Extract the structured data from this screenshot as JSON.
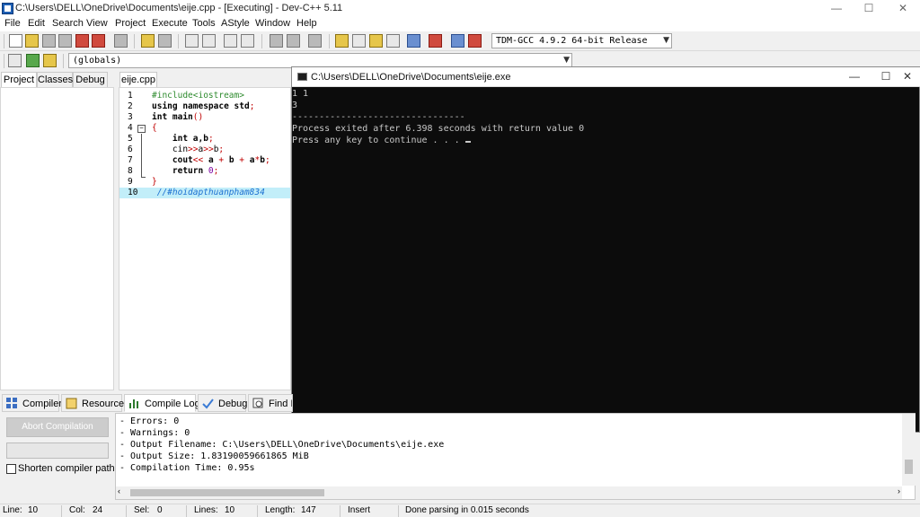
{
  "window": {
    "title": "C:\\Users\\DELL\\OneDrive\\Documents\\eije.cpp - [Executing] - Dev-C++ 5.11",
    "minimize": "—",
    "maximize": "☐",
    "close": "✕"
  },
  "menu": [
    "File",
    "Edit",
    "Search",
    "View",
    "Project",
    "Execute",
    "Tools",
    "AStyle",
    "Window",
    "Help"
  ],
  "toolbar": {
    "compiler_select": "TDM-GCC 4.9.2 64-bit Release",
    "scope_select": "(globals)"
  },
  "left_panel": {
    "tabs": [
      "Project",
      "Classes",
      "Debug"
    ]
  },
  "editor": {
    "file_tab": "eije.cpp",
    "lines": [
      {
        "n": "1",
        "segments": [
          {
            "t": "#include<iostream>",
            "c": "pp"
          }
        ]
      },
      {
        "n": "2",
        "segments": [
          {
            "t": "using namespace",
            "c": "kw"
          },
          {
            "t": " std",
            "c": "kw"
          },
          {
            "t": ";",
            "c": "op"
          }
        ]
      },
      {
        "n": "3",
        "segments": [
          {
            "t": "int",
            "c": "kw"
          },
          {
            "t": " main",
            "c": "kw"
          },
          {
            "t": "()",
            "c": "op"
          }
        ]
      },
      {
        "n": "4",
        "segments": [
          {
            "t": "{",
            "c": "op"
          }
        ]
      },
      {
        "n": "5",
        "segments": [
          {
            "t": "    int",
            "c": "kw"
          },
          {
            "t": " a,b",
            "c": "kw"
          },
          {
            "t": ";",
            "c": "op"
          }
        ]
      },
      {
        "n": "6",
        "segments": [
          {
            "t": "    cin",
            "c": ""
          },
          {
            "t": ">>",
            "c": "op"
          },
          {
            "t": "a",
            "c": ""
          },
          {
            "t": ">>",
            "c": "op"
          },
          {
            "t": "b",
            "c": ""
          },
          {
            "t": ";",
            "c": "op"
          }
        ]
      },
      {
        "n": "7",
        "segments": [
          {
            "t": "    cout",
            "c": "kw"
          },
          {
            "t": "<<",
            "c": "op"
          },
          {
            "t": " a ",
            "c": "kw"
          },
          {
            "t": "+",
            "c": "op"
          },
          {
            "t": " b ",
            "c": "kw"
          },
          {
            "t": "+",
            "c": "op"
          },
          {
            "t": " a",
            "c": "kw"
          },
          {
            "t": "*",
            "c": "op"
          },
          {
            "t": "b",
            "c": "kw"
          },
          {
            "t": ";",
            "c": "op"
          }
        ]
      },
      {
        "n": "8",
        "segments": [
          {
            "t": "    return",
            "c": "kw"
          },
          {
            "t": " 0",
            "c": "num"
          },
          {
            "t": ";",
            "c": "op"
          }
        ]
      },
      {
        "n": "9",
        "segments": [
          {
            "t": "}",
            "c": "op"
          }
        ]
      },
      {
        "n": "10",
        "segments": [
          {
            "t": " //#hoidapthuanpham834",
            "c": "cm"
          }
        ]
      }
    ],
    "highlighted_line": "10"
  },
  "console": {
    "title": "C:\\Users\\DELL\\OneDrive\\Documents\\eije.exe",
    "lines": [
      "1 1",
      "3",
      "--------------------------------",
      "Process exited after 6.398 seconds with return value 0",
      "Press any key to continue . . . "
    ]
  },
  "bottom_panel": {
    "tabs": [
      "Compiler",
      "Resources",
      "Compile Log",
      "Debug",
      "Find R"
    ],
    "active_tab": "Compile Log",
    "abort_label": "Abort Compilation",
    "progress": 0,
    "shorten_label": "Shorten compiler paths",
    "shorten_checked": false,
    "log_lines": [
      "- Errors: 0",
      "- Warnings: 0",
      "- Output Filename: C:\\Users\\DELL\\OneDrive\\Documents\\eije.exe",
      "- Output Size: 1.83190059661865 MiB",
      "- Compilation Time: 0.95s"
    ]
  },
  "status": {
    "line_label": "Line:",
    "line_value": "10",
    "col_label": "Col:",
    "col_value": "24",
    "sel_label": "Sel:",
    "sel_value": "0",
    "lines_label": "Lines:",
    "lines_value": "10",
    "length_label": "Length:",
    "length_value": "147",
    "mode": "Insert",
    "message": "Done parsing in 0.015 seconds"
  }
}
